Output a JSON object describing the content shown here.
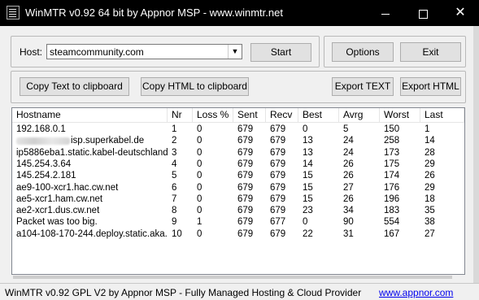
{
  "window": {
    "title": "WinMTR v0.92 64 bit by Appnor MSP - www.winmtr.net",
    "min_glyph": "",
    "max_glyph": "",
    "close_glyph": "✕"
  },
  "host": {
    "label": "Host:",
    "value": "steamcommunity.com",
    "dropdown_arrow": "▼"
  },
  "buttons": {
    "start": "Start",
    "options": "Options",
    "exit": "Exit",
    "copy_text": "Copy Text to clipboard",
    "copy_html": "Copy HTML to clipboard",
    "export_text": "Export TEXT",
    "export_html": "Export HTML"
  },
  "table": {
    "columns": [
      "Hostname",
      "Nr",
      "Loss %",
      "Sent",
      "Recv",
      "Best",
      "Avrg",
      "Worst",
      "Last"
    ],
    "rows": [
      {
        "hostname": "192.168.0.1",
        "nr": "1",
        "loss": "0",
        "sent": "679",
        "recv": "679",
        "best": "0",
        "avrg": "5",
        "worst": "150",
        "last": "1"
      },
      {
        "hostname": "isp.superkabel.de",
        "redacted": true,
        "nr": "2",
        "loss": "0",
        "sent": "679",
        "recv": "679",
        "best": "13",
        "avrg": "24",
        "worst": "258",
        "last": "14"
      },
      {
        "hostname": "ip5886eba1.static.kabel-deutschland...",
        "nr": "3",
        "loss": "0",
        "sent": "679",
        "recv": "679",
        "best": "13",
        "avrg": "24",
        "worst": "173",
        "last": "28"
      },
      {
        "hostname": "145.254.3.64",
        "nr": "4",
        "loss": "0",
        "sent": "679",
        "recv": "679",
        "best": "14",
        "avrg": "26",
        "worst": "175",
        "last": "29"
      },
      {
        "hostname": "145.254.2.181",
        "nr": "5",
        "loss": "0",
        "sent": "679",
        "recv": "679",
        "best": "15",
        "avrg": "26",
        "worst": "174",
        "last": "26"
      },
      {
        "hostname": "ae9-100-xcr1.hac.cw.net",
        "nr": "6",
        "loss": "0",
        "sent": "679",
        "recv": "679",
        "best": "15",
        "avrg": "27",
        "worst": "176",
        "last": "29"
      },
      {
        "hostname": "ae5-xcr1.ham.cw.net",
        "nr": "7",
        "loss": "0",
        "sent": "679",
        "recv": "679",
        "best": "15",
        "avrg": "26",
        "worst": "196",
        "last": "18"
      },
      {
        "hostname": "ae2-xcr1.dus.cw.net",
        "nr": "8",
        "loss": "0",
        "sent": "679",
        "recv": "679",
        "best": "23",
        "avrg": "34",
        "worst": "183",
        "last": "35"
      },
      {
        "hostname": "Packet was too big.",
        "nr": "9",
        "loss": "1",
        "sent": "679",
        "recv": "677",
        "best": "0",
        "avrg": "90",
        "worst": "554",
        "last": "38"
      },
      {
        "hostname": "a104-108-170-244.deploy.static.aka...",
        "nr": "10",
        "loss": "0",
        "sent": "679",
        "recv": "679",
        "best": "22",
        "avrg": "31",
        "worst": "167",
        "last": "27"
      }
    ]
  },
  "status": {
    "text": "WinMTR v0.92 GPL V2 by Appnor MSP - Fully Managed Hosting & Cloud Provider",
    "link": "www.appnor.com"
  }
}
